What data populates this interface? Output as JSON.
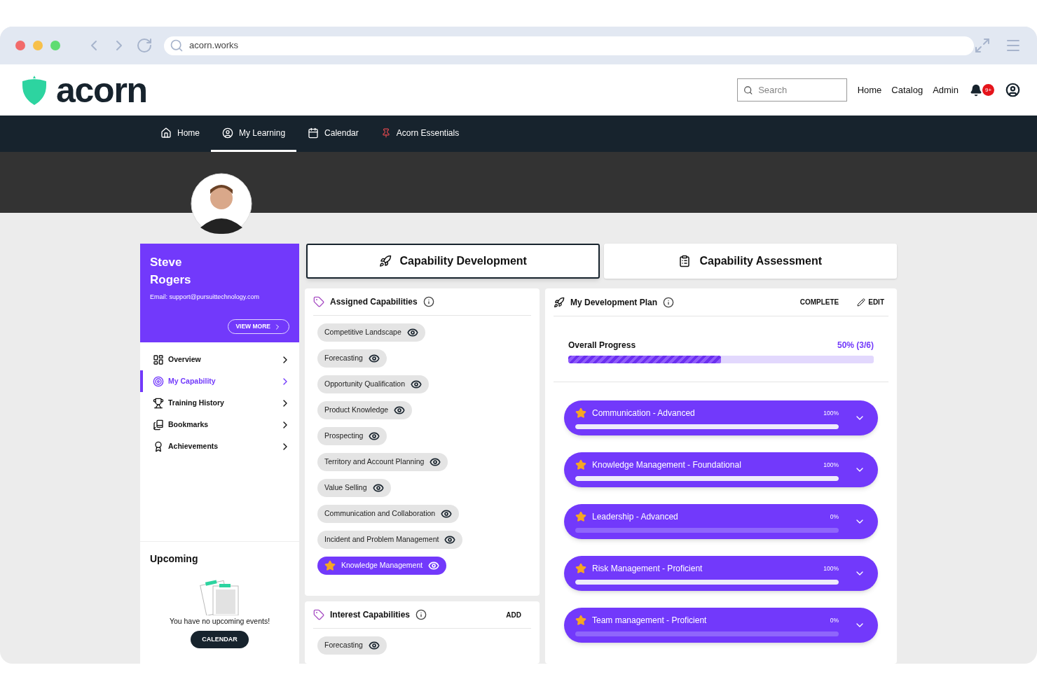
{
  "browser": {
    "url": "acorn.works"
  },
  "header": {
    "logo": "acorn",
    "search": {
      "placeholder": "Search"
    },
    "links": [
      "Home",
      "Catalog",
      "Admin"
    ],
    "notification_badge": "9+"
  },
  "nav": [
    {
      "label": "Home",
      "selected": false
    },
    {
      "label": "My Learning",
      "selected": true
    },
    {
      "label": "Calendar",
      "selected": false
    },
    {
      "label": "Acorn Essentials",
      "selected": false
    }
  ],
  "profile": {
    "name": "Steve Rogers",
    "email": "Email: support@pursuittechnology.com",
    "view_more": "VIEW MORE"
  },
  "sidebar": {
    "items": [
      {
        "label": "Overview",
        "selected": false
      },
      {
        "label": "My Capability",
        "selected": true
      },
      {
        "label": "Training History",
        "selected": false
      },
      {
        "label": "Bookmarks",
        "selected": false
      },
      {
        "label": "Achievements",
        "selected": false
      }
    ]
  },
  "upcoming": {
    "title": "Upcoming",
    "message": "You have no upcoming events!",
    "button": "CALENDAR"
  },
  "tabs": [
    {
      "label": "Capability Development",
      "selected": true
    },
    {
      "label": "Capability Assessment",
      "selected": false
    }
  ],
  "assigned": {
    "title": "Assigned Capabilities",
    "items": [
      {
        "label": "Competitive Landscape",
        "starred": false
      },
      {
        "label": "Forecasting",
        "starred": false
      },
      {
        "label": "Opportunity Qualification",
        "starred": false
      },
      {
        "label": "Product Knowledge",
        "starred": false
      },
      {
        "label": "Prospecting",
        "starred": false
      },
      {
        "label": "Territory and Account Planning",
        "starred": false
      },
      {
        "label": "Value Selling",
        "starred": false
      },
      {
        "label": "Communication and Collaboration",
        "starred": false
      },
      {
        "label": "Incident and Problem Management",
        "starred": false
      },
      {
        "label": "Knowledge Management",
        "starred": true
      }
    ]
  },
  "interest": {
    "title": "Interest Capabilities",
    "action": "ADD",
    "items": [
      {
        "label": "Forecasting",
        "starred": false
      }
    ]
  },
  "plan": {
    "title": "My Development Plan",
    "complete": "COMPLETE",
    "edit": "EDIT",
    "overall": {
      "label": "Overall Progress",
      "reading": "50% (3/6)",
      "level": 0.5
    },
    "goals": [
      {
        "label": "Communication - Advanced",
        "reading": "100%",
        "level": 1
      },
      {
        "label": "Knowledge Management - Foundational",
        "reading": "100%",
        "level": 1
      },
      {
        "label": "Leadership - Advanced",
        "reading": "0%",
        "level": 0
      },
      {
        "label": "Risk Management - Proficient",
        "reading": "100%",
        "level": 1
      },
      {
        "label": "Team management - Proficient",
        "reading": "0%",
        "level": 0
      }
    ]
  }
}
